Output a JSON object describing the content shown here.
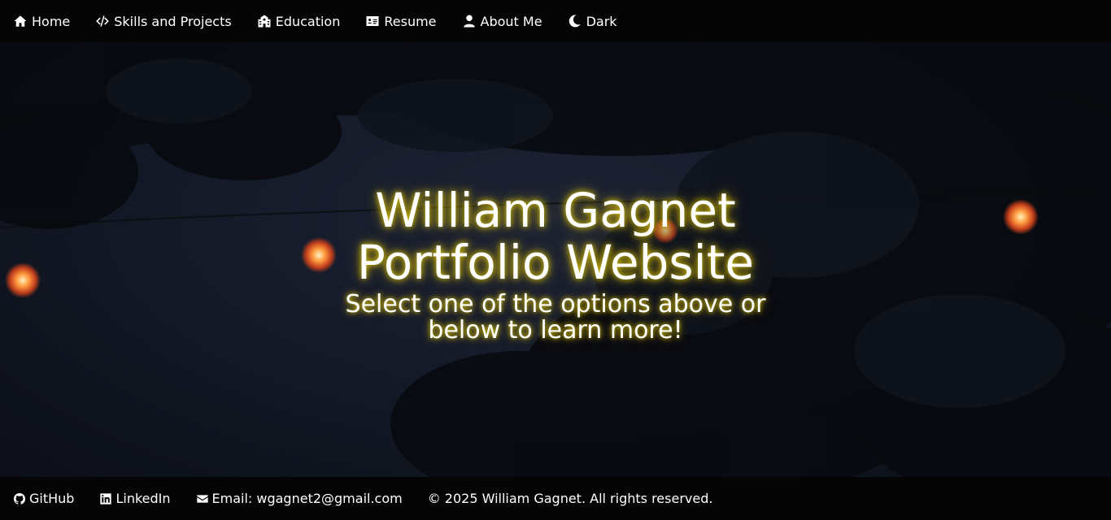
{
  "nav": {
    "items": [
      {
        "label": "Home",
        "icon": "home-icon"
      },
      {
        "label": "Skills and Projects",
        "icon": "code-icon"
      },
      {
        "label": "Education",
        "icon": "school-icon"
      },
      {
        "label": "Resume",
        "icon": "id-card-icon"
      },
      {
        "label": "About Me",
        "icon": "user-icon"
      },
      {
        "label": "Dark",
        "icon": "moon-icon"
      }
    ]
  },
  "hero": {
    "title_line1": "William Gagnet",
    "title_line2": "Portfolio Website",
    "subtitle": "Select one of the options above or below to learn more!",
    "glow_color": "#ffe600"
  },
  "footer": {
    "github_label": "GitHub",
    "linkedin_label": "LinkedIn",
    "email_label": "Email: wgagnet2@gmail.com",
    "copyright": "© 2025 William Gagnet. All rights reserved."
  },
  "colors": {
    "bar_background": "#050505",
    "hero_background": "#141a28",
    "text": "#ffffff"
  }
}
